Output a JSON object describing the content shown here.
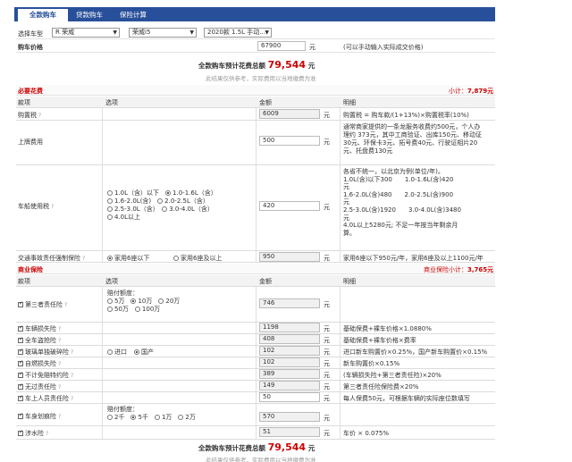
{
  "tabs": [
    {
      "label": "全款购车"
    },
    {
      "label": "贷款购车"
    },
    {
      "label": "保险计算"
    }
  ],
  "select_car": {
    "label": "选择车型",
    "brand": "R 荣威",
    "series": "荣威i5",
    "model": "2020款 1.5L 手动..."
  },
  "price": {
    "label": "购车价格",
    "value": "67900",
    "unit": "元",
    "hint": "(可以手动输入实际成交价格)"
  },
  "total_top": {
    "label": "全款购车预计花费总额",
    "amount": "79,544",
    "unit": "元",
    "note": "此结果仅供参考，实际费用以当地缴费为准"
  },
  "required": {
    "title": "必要花费",
    "subtotal_label": "小计：",
    "subtotal": "7,879元"
  },
  "columns": {
    "item": "款项",
    "option": "选项",
    "amount": "金额",
    "detail": "明细"
  },
  "req_rows": {
    "purchase_tax": {
      "name": "购置税",
      "value": "6009",
      "unit": "元",
      "detail": "购置税 = 购车款/(1+13%)×购置税率(10%)"
    },
    "plate": {
      "name": "上牌费用",
      "value": "500",
      "unit": "元",
      "detail": [
        "通常商家提供的一条龙服务收费约500元，个人办",
        "理约 373元，其中工商验证、出库150元、移动证",
        "30元、环保卡3元、拓号费40元、行驶证相片20",
        "元、托盘费130元"
      ]
    },
    "vessel": {
      "name": "车船使用税",
      "value": "420",
      "unit": "元",
      "options": [
        "1.0L（含）以下",
        "1.0-1.6L（含）",
        "1.6-2.0L(含)",
        "2.0-2.5L（含）",
        "2.5-3.0L（含）",
        "3.0-4.0L（含）",
        "4.0L以上"
      ],
      "detail": [
        "各省不统一，以北京为例(单位/年)。",
        "1.0L(含)以下300　　1.0-1.6L(含)420",
        "元",
        "1.6-2.0L(含)480　　2.0-2.5L(含)900",
        "元",
        "2.5-3.0L(含)1920　　3.0-4.0L(含)3480",
        "元",
        "4.0L以上5280元; 不足一年按当年剩余月",
        "算。"
      ]
    },
    "compulsory": {
      "name": "交通事故责任强制保险",
      "value": "950",
      "unit": "元",
      "options": [
        "家用6座以下",
        "家用6座及以上"
      ],
      "detail": "家用6座以下950元/年，家用6座及以上1100元/年"
    }
  },
  "commercial": {
    "title": "商业保险",
    "subtotal_label": "商业保险小计：",
    "subtotal": "3,765元"
  },
  "com_rows": {
    "third_party": {
      "name": "第三者责任险",
      "value": "746",
      "unit": "元",
      "opt_label": "赔付额度：",
      "options": [
        "5万",
        "10万",
        "20万",
        "50万",
        "100万"
      ]
    },
    "damage": {
      "name": "车辆损失险",
      "value": "1198",
      "unit": "元",
      "detail": "基础保费+裸车价格×1.0880%"
    },
    "theft": {
      "name": "全车盗抢险",
      "value": "408",
      "unit": "元",
      "detail": "基础保费+裸车价格×费率"
    },
    "glass": {
      "name": "玻璃单独破碎险",
      "value": "102",
      "unit": "元",
      "options": [
        "进口",
        "国产"
      ],
      "detail": "进口新车购置价×0.25%，国产新车购置价×0.15%"
    },
    "fire": {
      "name": "自燃损失险",
      "value": "102",
      "unit": "元",
      "detail": "新车购置价×0.15%"
    },
    "deductible": {
      "name": "不计免赔特约险",
      "value": "389",
      "unit": "元",
      "detail": "(车辆损失险+第三者责任险)×20%"
    },
    "no_fault": {
      "name": "无过责任险",
      "value": "149",
      "unit": "元",
      "detail": "第三者责任险保险费×20%"
    },
    "passenger": {
      "name": "车上人员责任险",
      "value": "50",
      "unit": "元",
      "detail": "每人保费50元，可根据车辆的实际座位数填写"
    },
    "scratch": {
      "name": "车身划痕险",
      "value": "570",
      "unit": "元",
      "opt_label": "赔付额度：",
      "options": [
        "2千",
        "5千",
        "1万",
        "2万"
      ]
    },
    "water": {
      "name": "涉水险",
      "value": "51",
      "unit": "元",
      "detail": "车价 × 0.075%"
    }
  },
  "total_bottom": {
    "label": "全款购车预计花费总额",
    "amount": "79,544",
    "unit": "元",
    "note": "此结果仅供参考，实际费用以当地缴费为准"
  }
}
